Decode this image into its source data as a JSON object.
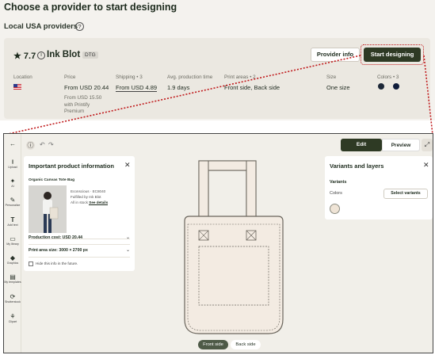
{
  "header": {
    "title": "Choose a provider to start designing",
    "subtitle": "Local USA providers",
    "help_icon": "?"
  },
  "provider": {
    "rating": "★ 7.7",
    "info_icon": "i",
    "name": "Ink Blot",
    "badge": "DTG",
    "info_button": "Provider info",
    "start_button": "Start designing",
    "columns": {
      "location_label": "Location",
      "price_label": "Price",
      "price_value": "From USD 20.44",
      "price_sub": [
        "From USD 15.50",
        "with Printify",
        "Premium"
      ],
      "shipping_label": "Shipping • 3",
      "shipping_value": "From USD 4.89",
      "production_label": "Avg. production time",
      "production_value": "1.9 days",
      "print_areas_label": "Print areas • 2",
      "print_areas_value": "Front side, Back side",
      "size_label": "Size",
      "size_value": "One size",
      "colors_label": "Colors • 3",
      "color_swatches": [
        "#1d2838",
        "#0f1c3a"
      ]
    }
  },
  "rail": [
    {
      "icon": "⭱",
      "label": "Upload",
      "name": "upload"
    },
    {
      "icon": "✦",
      "label": "AI",
      "name": "ai"
    },
    {
      "icon": "✎",
      "label": "Personalize",
      "name": "personalize"
    },
    {
      "icon": "T",
      "label": "Add text",
      "name": "add-text"
    },
    {
      "icon": "▭",
      "label": "My library",
      "name": "my-library"
    },
    {
      "icon": "◆",
      "label": "Graphics",
      "name": "graphics"
    },
    {
      "icon": "▤",
      "label": "My templates",
      "name": "my-templates"
    },
    {
      "icon": "⟳",
      "label": "Shutterstock",
      "name": "shutterstock"
    },
    {
      "icon": "⚘",
      "label": "Clipart",
      "name": "clipart"
    }
  ],
  "editor": {
    "back_icon": "←",
    "info_icon": "ⓘ",
    "undo_icon": "↶",
    "redo_icon": "↷",
    "edit_tab": "Edit",
    "preview_tab": "Preview",
    "expand_icon": "⤢",
    "front_tab": "Front side",
    "back_tab": "Back side"
  },
  "info_panel": {
    "title": "Important product information",
    "close": "✕",
    "product_name": "Organic Canvas Tote Bag",
    "meta": [
      "Econscious · EC8040",
      "Fulfilled by Ink Blot",
      "All in stock"
    ],
    "see_details": "See details",
    "production_cost": "Production cost: USD 20.44",
    "print_area": "Print area size: 3000 × 2700 px",
    "chevron": "⌄",
    "hide_label": "Hide this info in the future."
  },
  "variants_panel": {
    "title": "Variants and layers",
    "close": "✕",
    "variants_label": "Variants",
    "colors_label": "Colors",
    "select_button": "Select variants",
    "selected_color": "#efe4d6"
  },
  "colors": {
    "brand_dark": "#2e3a24",
    "accent_red": "#c0191b",
    "tote": "#f3ebe2"
  }
}
